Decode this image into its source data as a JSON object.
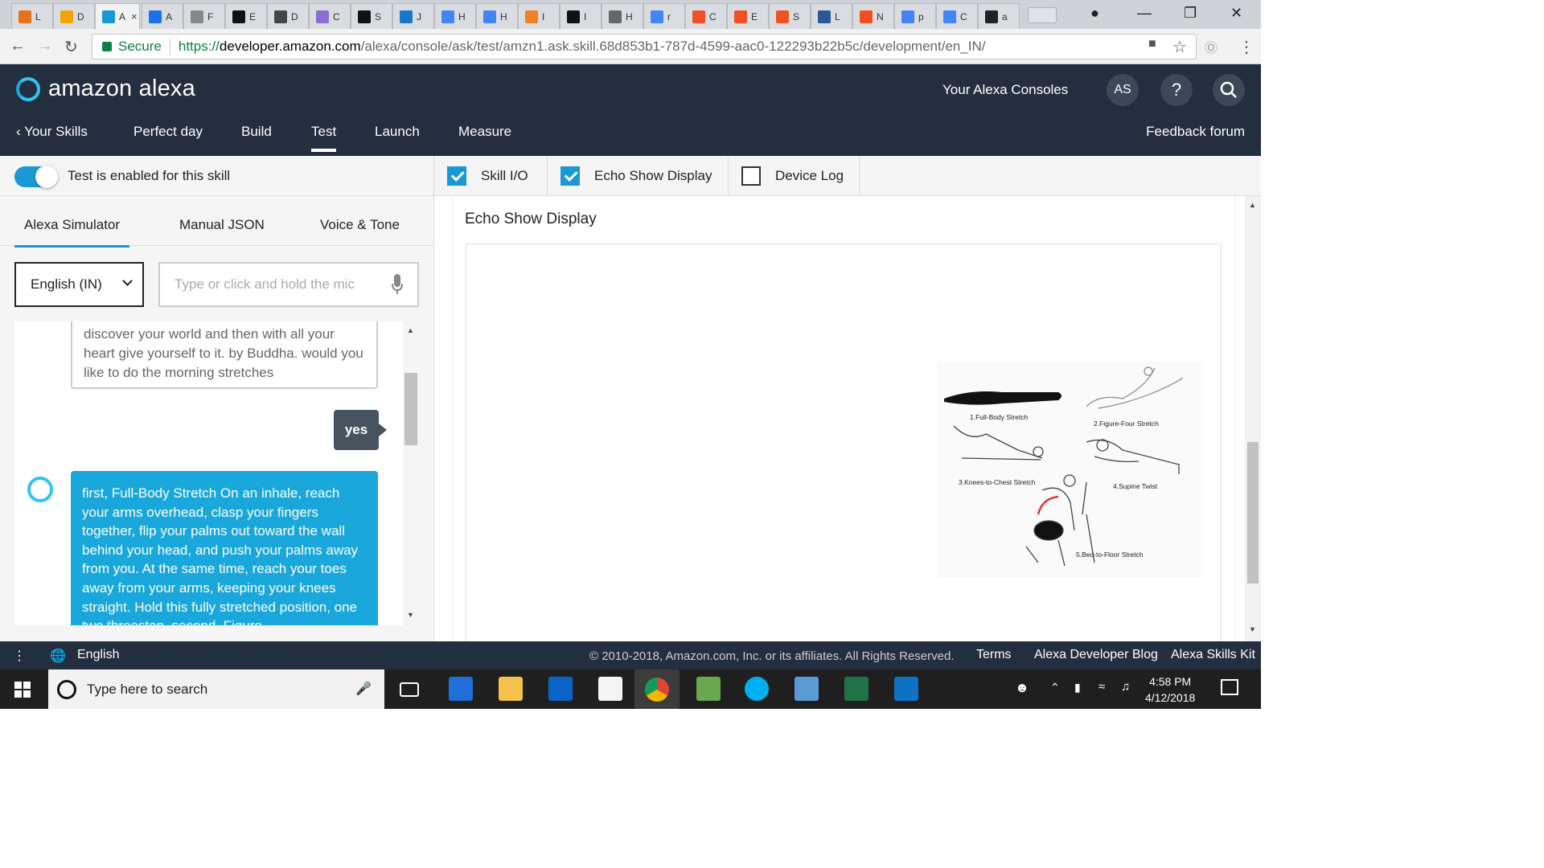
{
  "browser": {
    "tabs": [
      {
        "label": "L",
        "color": "#e8711c"
      },
      {
        "label": "D",
        "color": "#f0a500"
      },
      {
        "label": "A",
        "color": "#1a98d5",
        "active": true
      },
      {
        "label": "A",
        "color": "#1a73e8"
      },
      {
        "label": "F",
        "color": "#888888"
      },
      {
        "label": "E",
        "color": "#111111"
      },
      {
        "label": "D",
        "color": "#444444"
      },
      {
        "label": "C",
        "color": "#8a6fd1"
      },
      {
        "label": "S",
        "color": "#111111"
      },
      {
        "label": "J",
        "color": "#1877c9"
      },
      {
        "label": "H",
        "color": "#4285f4"
      },
      {
        "label": "H",
        "color": "#4285f4"
      },
      {
        "label": "I",
        "color": "#f48024"
      },
      {
        "label": "I",
        "color": "#111111"
      },
      {
        "label": "H",
        "color": "#666666"
      },
      {
        "label": "r",
        "color": "#4285f4"
      },
      {
        "label": "C",
        "color": "#f25022"
      },
      {
        "label": "E",
        "color": "#f25022"
      },
      {
        "label": "S",
        "color": "#f25022"
      },
      {
        "label": "L",
        "color": "#2b579a"
      },
      {
        "label": "N",
        "color": "#f25022"
      },
      {
        "label": "p",
        "color": "#4285f4"
      },
      {
        "label": "C",
        "color": "#4285f4"
      },
      {
        "label": "a",
        "color": "#222222"
      }
    ],
    "secure_label": "Secure",
    "url_scheme": "https://",
    "url_host": "developer.amazon.com",
    "url_path": "/alexa/console/ask/test/amzn1.ask.skill.68d853b1-787d-4599-aac0-122293b22b5c/development/en_IN/"
  },
  "header": {
    "logo_text": "amazon alexa",
    "consoles_label": "Your Alexa Consoles",
    "avatar_initials": "AS",
    "help_label": "?",
    "nav": {
      "back_label": "Your Skills",
      "skill_name": "Perfect day",
      "build": "Build",
      "test": "Test",
      "launch": "Launch",
      "measure": "Measure"
    },
    "feedback_label": "Feedback forum"
  },
  "simulator": {
    "toggle_label": "Test is enabled for this skill",
    "tabs": [
      "Alexa Simulator",
      "Manual JSON",
      "Voice & Tone"
    ],
    "language": "English (IN)",
    "utterance_placeholder": "Type or click and hold the mic",
    "messages": {
      "previous": "discover your world and then with all your heart give yourself to it. by Buddha. would you like to do the morning stretches",
      "user": "yes",
      "alexa": "first, Full-Body Stretch On an inhale, reach your arms overhead, clasp your fingers together, flip your palms out toward the wall behind your head, and push your palms away from you. At the same time, reach your toes away from your arms, keeping your knees straight. Hold this fully stretched position, one two threestop. second, Figure"
    }
  },
  "display_options": {
    "skill_io": {
      "label": "Skill I/O",
      "checked": true
    },
    "echo_show": {
      "label": "Echo Show Display",
      "checked": true
    },
    "device_log": {
      "label": "Device Log",
      "checked": false
    }
  },
  "echo_show": {
    "title": "Echo Show Display",
    "image_labels": [
      "1.Full-Body Stretch",
      "2.Figure-Four Stretch",
      "3.Knees-to-Chest Stretch",
      "4.Supine Twist",
      "5.Bed-to-Floor Stretch"
    ]
  },
  "footer": {
    "language": "English",
    "copyright": "© 2010-2018, Amazon.com, Inc. or its affiliates. All Rights Reserved.",
    "links": [
      "Terms",
      "Alexa Developer Blog",
      "Alexa Skills Kit"
    ]
  },
  "taskbar": {
    "search_placeholder": "Type here to search",
    "time": "4:58 PM",
    "date": "4/12/2018"
  },
  "colors": {
    "header_bg": "#232f3e",
    "accent": "#1a98d5",
    "alexa_bubble": "#1aa8dc",
    "user_bubble": "#475460"
  }
}
